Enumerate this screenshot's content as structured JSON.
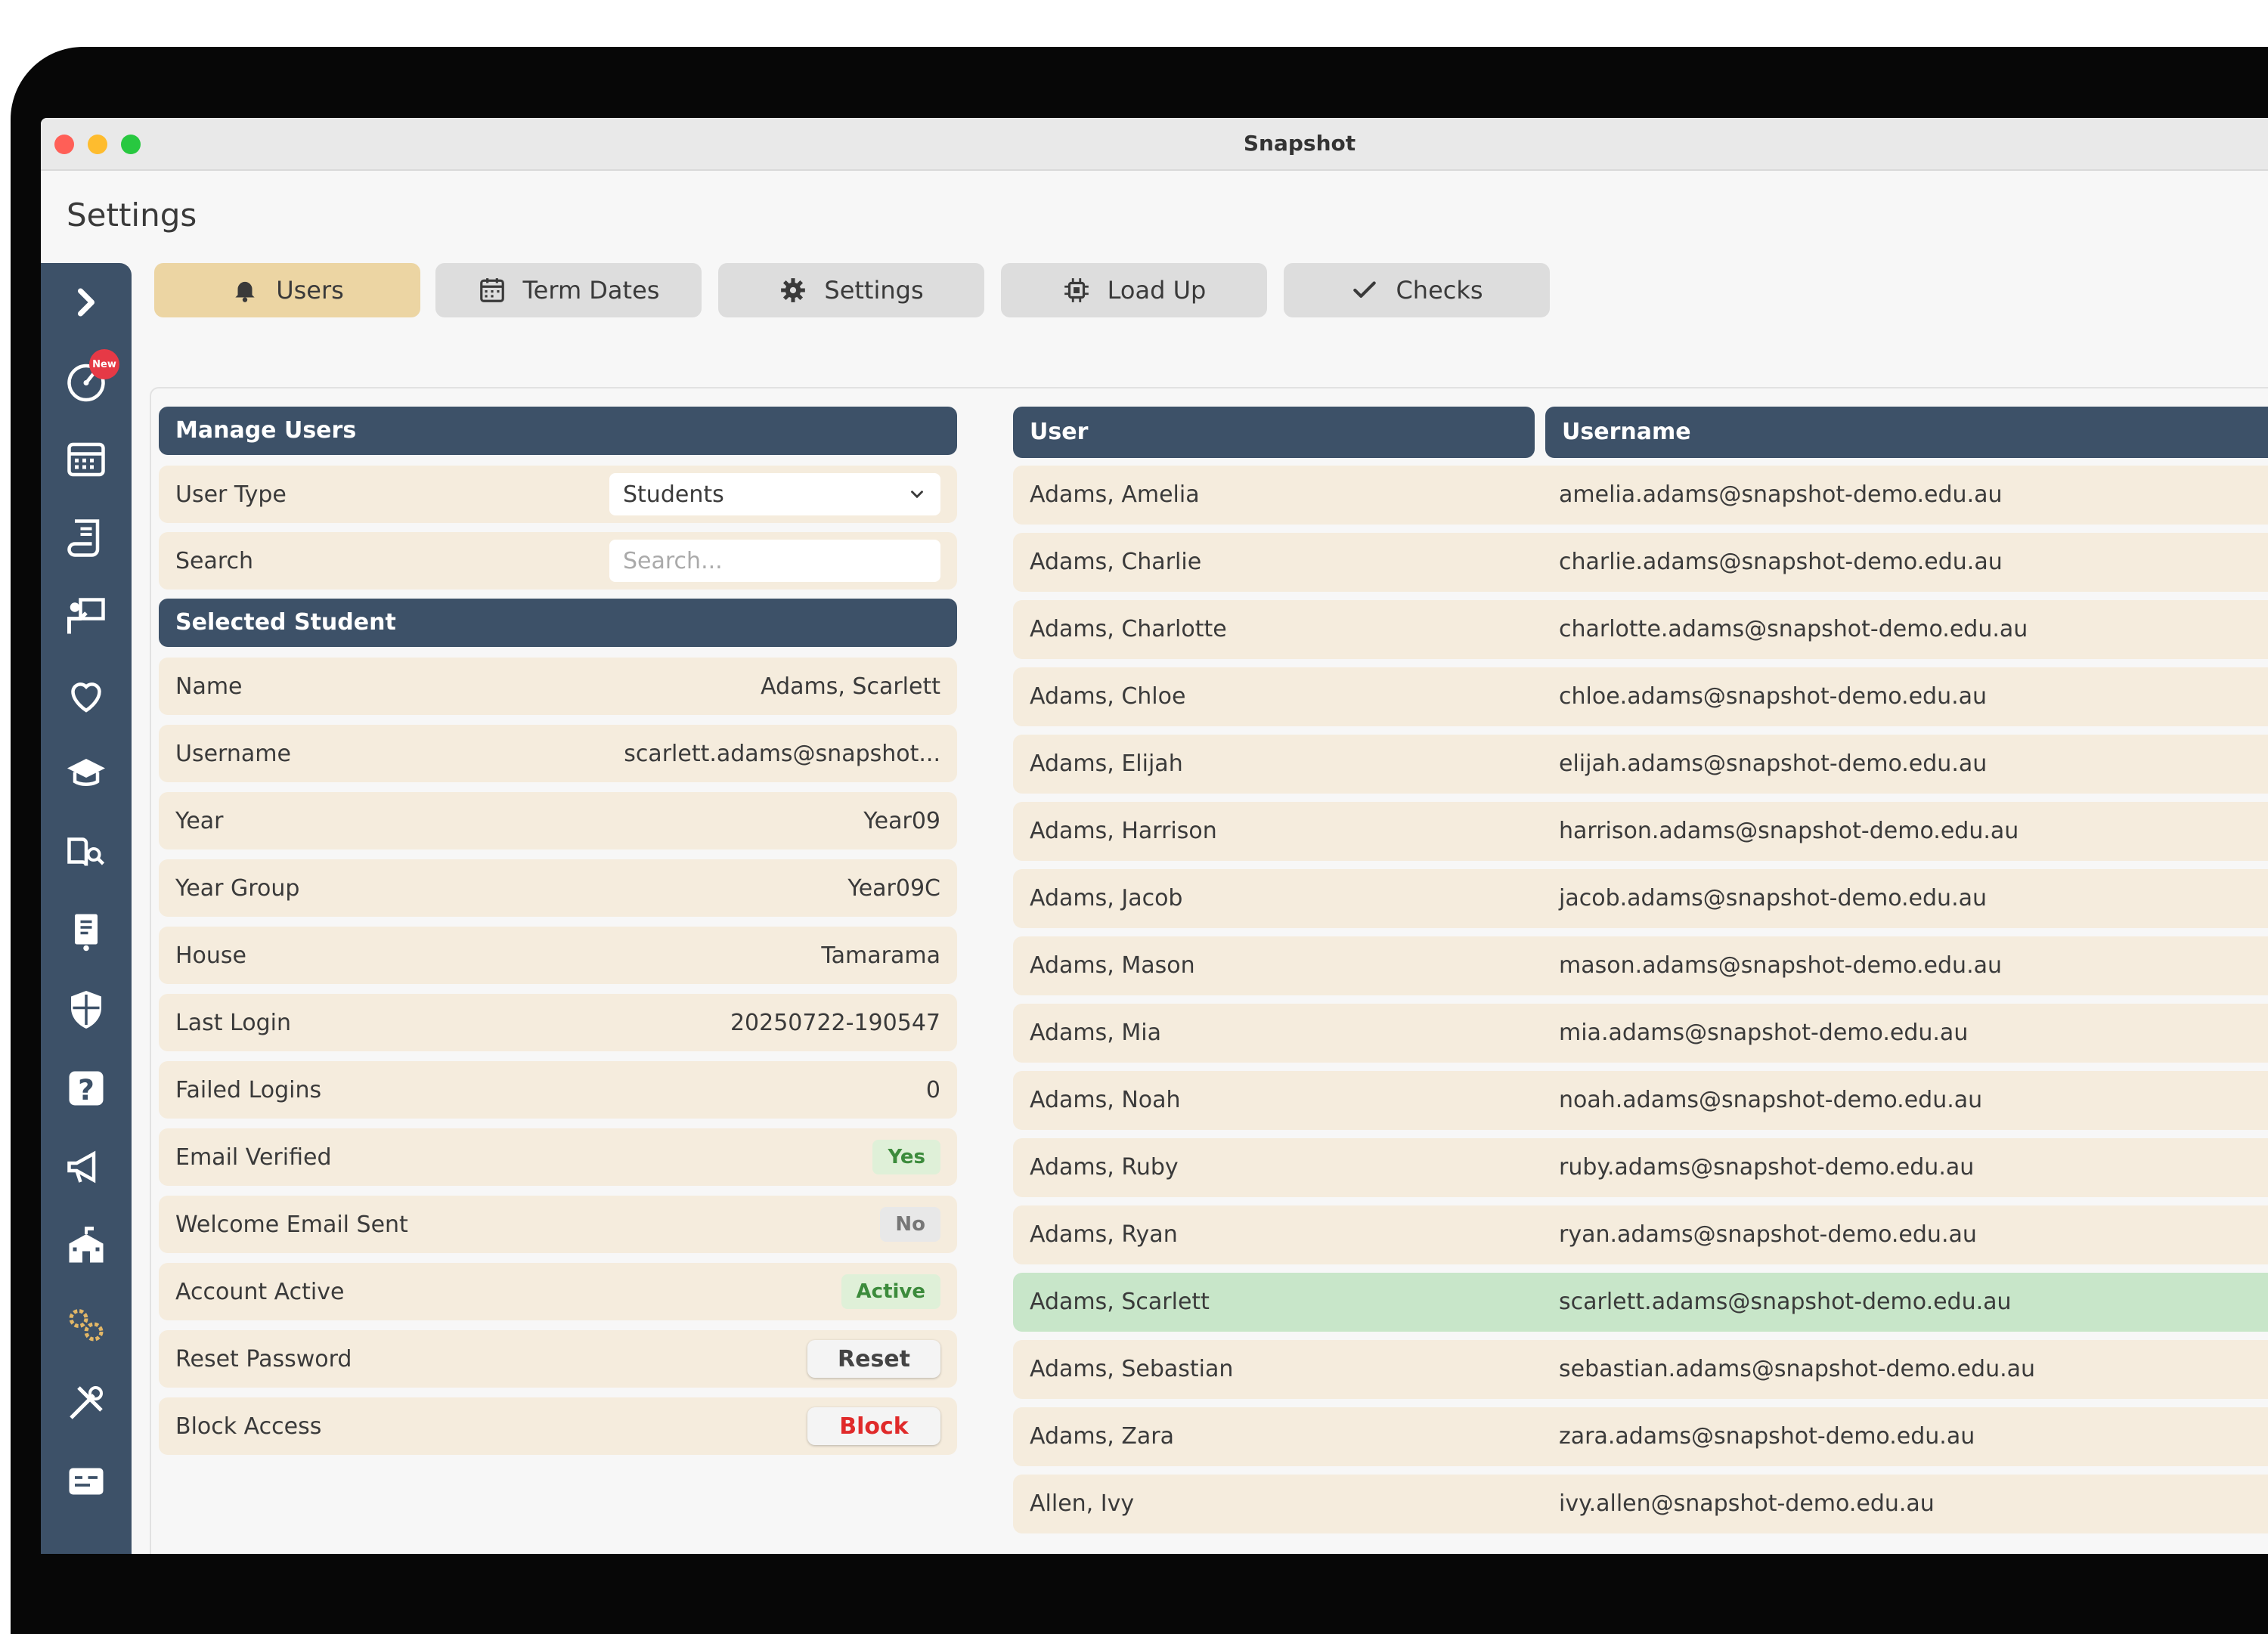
{
  "window": {
    "title": "Snapshot"
  },
  "page": {
    "title": "Settings"
  },
  "sidebar": {
    "new_badge": "New",
    "items": [
      {
        "icon": "chevron-right-icon"
      },
      {
        "icon": "gauge-icon"
      },
      {
        "icon": "calendar-icon"
      },
      {
        "icon": "scroll-icon"
      },
      {
        "icon": "teacher-icon"
      },
      {
        "icon": "heart-icon"
      },
      {
        "icon": "graduation-cap-icon"
      },
      {
        "icon": "book-search-icon"
      },
      {
        "icon": "document-icon"
      },
      {
        "icon": "shield-icon"
      },
      {
        "icon": "help-icon"
      },
      {
        "icon": "megaphone-icon"
      },
      {
        "icon": "school-icon"
      },
      {
        "icon": "gears-icon"
      },
      {
        "icon": "tools-icon"
      },
      {
        "icon": "id-card-icon"
      }
    ]
  },
  "tabs": [
    {
      "label": "Users",
      "icon": "bell-icon",
      "active": true
    },
    {
      "label": "Term Dates",
      "icon": "calendar-icon",
      "active": false
    },
    {
      "label": "Settings",
      "icon": "gear-icon",
      "active": false
    },
    {
      "label": "Load Up",
      "icon": "chip-icon",
      "active": false
    },
    {
      "label": "Checks",
      "icon": "check-icon",
      "active": false
    }
  ],
  "manage_users": {
    "header": "Manage Users",
    "user_type_label": "User Type",
    "user_type_value": "Students",
    "search_label": "Search",
    "search_placeholder": "Search..."
  },
  "selected_student": {
    "header": "Selected Student",
    "fields": {
      "name": {
        "label": "Name",
        "value": "Adams, Scarlett"
      },
      "username": {
        "label": "Username",
        "value": "scarlett.adams@snapshot..."
      },
      "year": {
        "label": "Year",
        "value": "Year09"
      },
      "year_group": {
        "label": "Year Group",
        "value": "Year09C"
      },
      "house": {
        "label": "House",
        "value": "Tamarama"
      },
      "last_login": {
        "label": "Last Login",
        "value": "20250722-190547"
      },
      "failed_logins": {
        "label": "Failed Logins",
        "value": "0"
      },
      "email_verified": {
        "label": "Email Verified",
        "value": "Yes"
      },
      "welcome_email": {
        "label": "Welcome Email Sent",
        "value": "No"
      },
      "account_active": {
        "label": "Account Active",
        "value": "Active"
      },
      "reset_password": {
        "label": "Reset Password",
        "button": "Reset"
      },
      "block_access": {
        "label": "Block Access",
        "button": "Block"
      }
    }
  },
  "user_table": {
    "headers": [
      "User",
      "Username"
    ],
    "rows": [
      {
        "user": "Adams, Amelia",
        "username": "amelia.adams@snapshot-demo.edu.au"
      },
      {
        "user": "Adams, Charlie",
        "username": "charlie.adams@snapshot-demo.edu.au"
      },
      {
        "user": "Adams, Charlotte",
        "username": "charlotte.adams@snapshot-demo.edu.au"
      },
      {
        "user": "Adams, Chloe",
        "username": "chloe.adams@snapshot-demo.edu.au"
      },
      {
        "user": "Adams, Elijah",
        "username": "elijah.adams@snapshot-demo.edu.au"
      },
      {
        "user": "Adams, Harrison",
        "username": "harrison.adams@snapshot-demo.edu.au"
      },
      {
        "user": "Adams, Jacob",
        "username": "jacob.adams@snapshot-demo.edu.au"
      },
      {
        "user": "Adams, Mason",
        "username": "mason.adams@snapshot-demo.edu.au"
      },
      {
        "user": "Adams, Mia",
        "username": "mia.adams@snapshot-demo.edu.au"
      },
      {
        "user": "Adams, Noah",
        "username": "noah.adams@snapshot-demo.edu.au"
      },
      {
        "user": "Adams, Ruby",
        "username": "ruby.adams@snapshot-demo.edu.au"
      },
      {
        "user": "Adams, Ryan",
        "username": "ryan.adams@snapshot-demo.edu.au"
      },
      {
        "user": "Adams, Scarlett",
        "username": "scarlett.adams@snapshot-demo.edu.au",
        "selected": true
      },
      {
        "user": "Adams, Sebastian",
        "username": "sebastian.adams@snapshot-demo.edu.au"
      },
      {
        "user": "Adams, Zara",
        "username": "zara.adams@snapshot-demo.edu.au"
      },
      {
        "user": "Allen, Ivy",
        "username": "ivy.allen@snapshot-demo.edu.au"
      }
    ]
  },
  "colors": {
    "sidebar": "#3d5168",
    "tab_active": "#ecd5a3",
    "row_bg": "#f5ecdd",
    "row_selected": "#c8e6c9",
    "block_red": "#e02a2a",
    "badge_red": "#e63946"
  }
}
